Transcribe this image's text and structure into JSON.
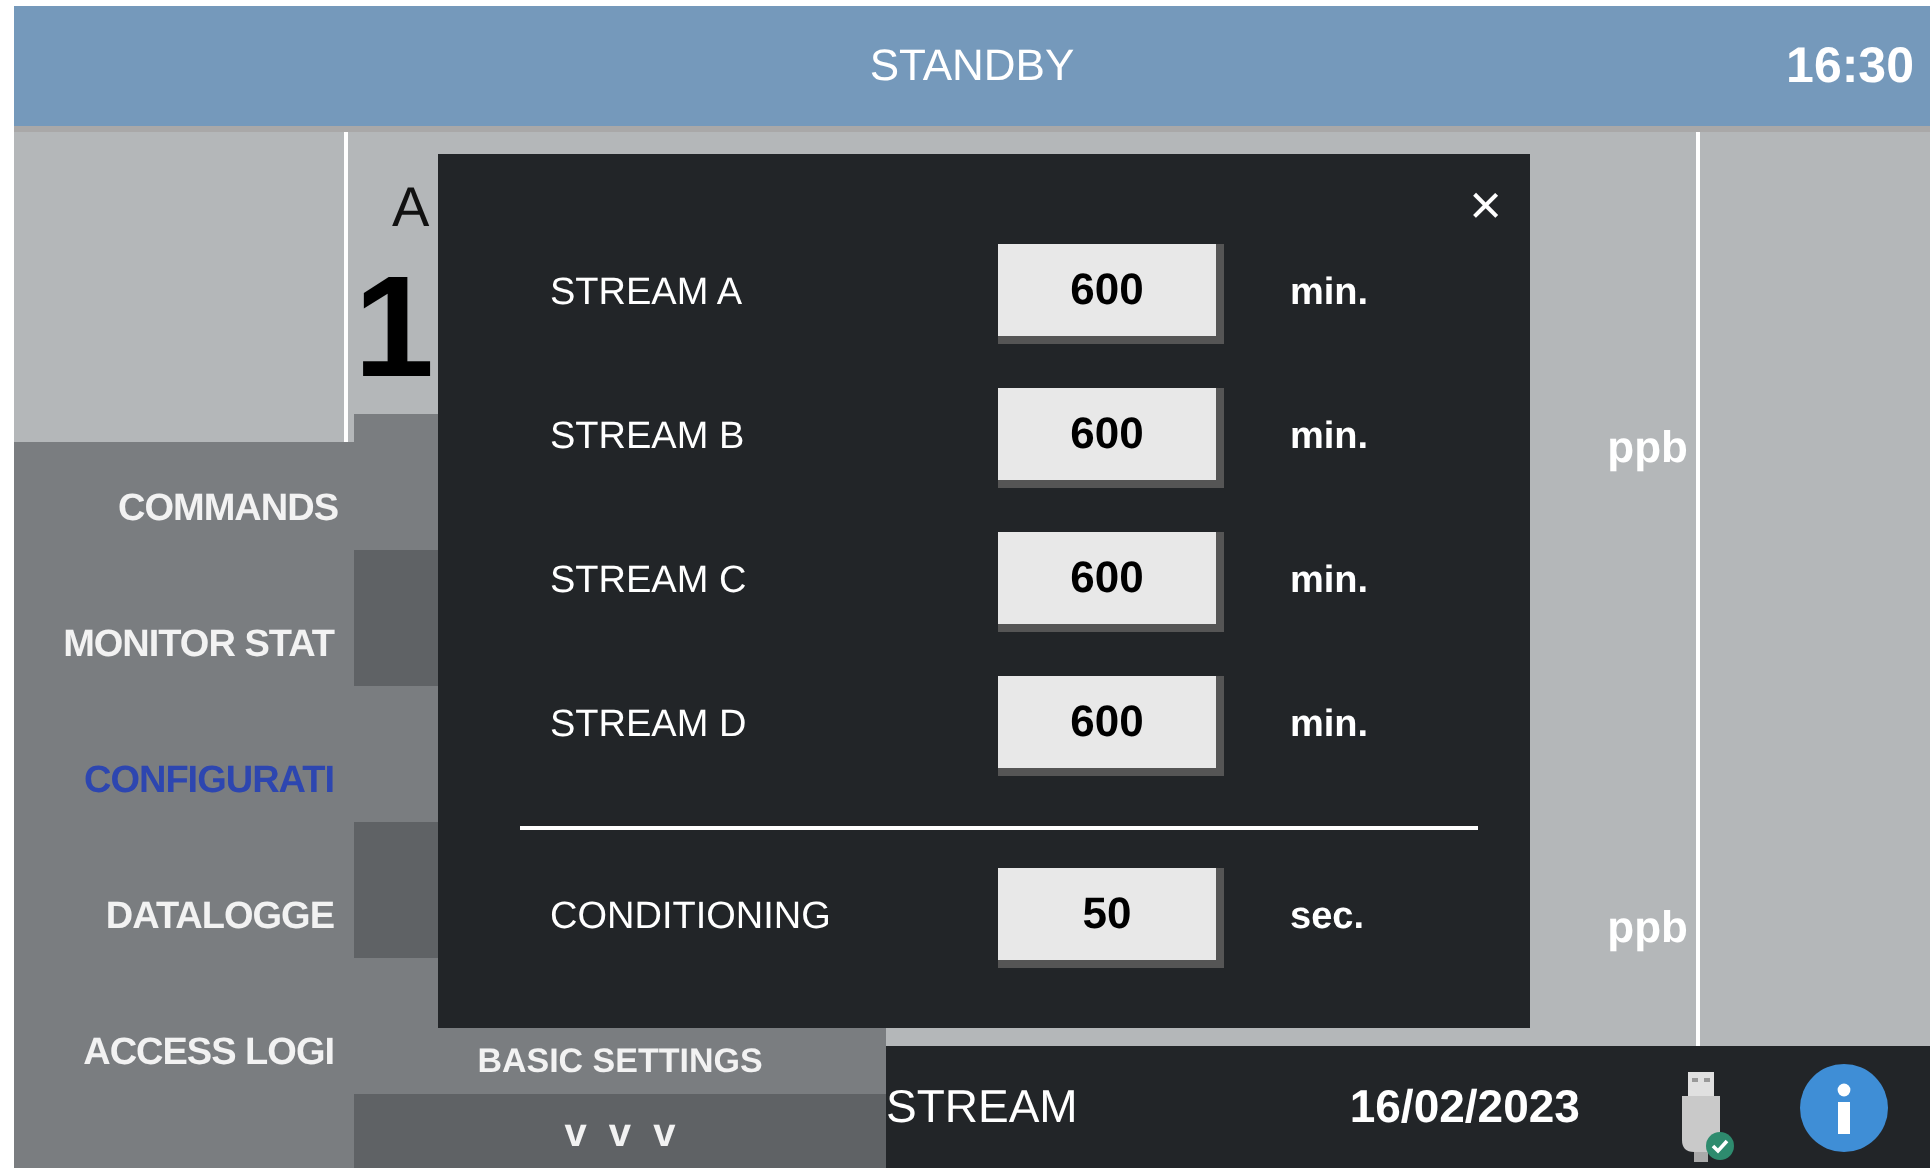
{
  "header": {
    "status": "STANDBY",
    "time": "16:30"
  },
  "main": {
    "label": "A",
    "value": "1",
    "units": [
      "ppb",
      "ppb"
    ]
  },
  "side_menu": {
    "items": [
      {
        "label": "COMMANDS",
        "selected": false
      },
      {
        "label": "MONITOR STAT",
        "selected": false
      },
      {
        "label": "CONFIGURATI",
        "selected": true
      },
      {
        "label": "DATALOGGE",
        "selected": false
      },
      {
        "label": "ACCESS LOGI",
        "selected": false
      }
    ]
  },
  "submenu": {
    "items": [
      "BASIC SETTINGS"
    ],
    "more": "v  v  v"
  },
  "dialog": {
    "close": "×",
    "rows": [
      {
        "label": "STREAM A",
        "value": "600",
        "unit": "min."
      },
      {
        "label": "STREAM B",
        "value": "600",
        "unit": "min."
      },
      {
        "label": "STREAM C",
        "value": "600",
        "unit": "min."
      },
      {
        "label": "STREAM D",
        "value": "600",
        "unit": "min."
      }
    ],
    "conditioning": {
      "label": "CONDITIONING",
      "value": "50",
      "unit": "sec."
    }
  },
  "status_bar": {
    "stream": "STREAM",
    "date": "16/02/2023"
  }
}
